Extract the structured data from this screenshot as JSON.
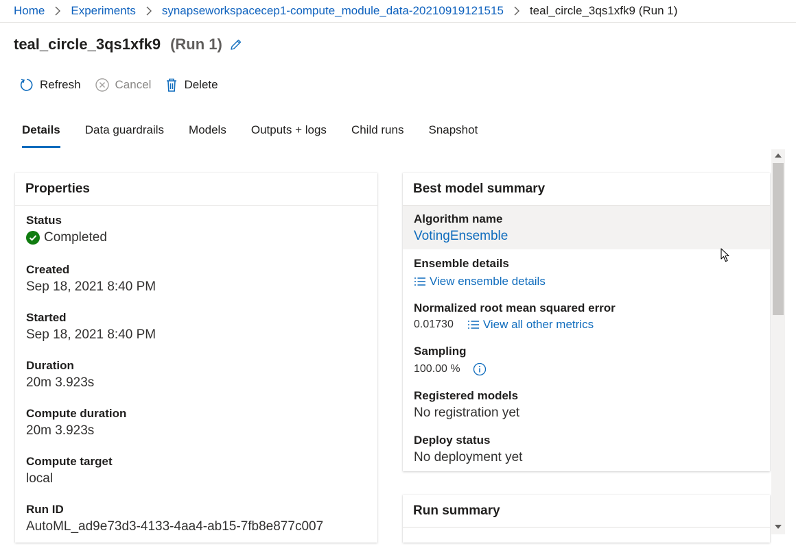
{
  "breadcrumb": {
    "home": "Home",
    "experiments": "Experiments",
    "experiment": "synapseworkspacecep1-compute_module_data-20210919121515",
    "current": "teal_circle_3qs1xfk9 (Run 1)"
  },
  "header": {
    "title": "teal_circle_3qs1xfk9",
    "run": "(Run 1)"
  },
  "toolbar": {
    "refresh": "Refresh",
    "cancel": "Cancel",
    "delete": "Delete"
  },
  "tabs": [
    "Details",
    "Data guardrails",
    "Models",
    "Outputs + logs",
    "Child runs",
    "Snapshot"
  ],
  "properties": {
    "title": "Properties",
    "status_label": "Status",
    "status_value": "Completed",
    "created_label": "Created",
    "created_value": "Sep 18, 2021 8:40 PM",
    "started_label": "Started",
    "started_value": "Sep 18, 2021 8:40 PM",
    "duration_label": "Duration",
    "duration_value": "20m 3.923s",
    "compute_duration_label": "Compute duration",
    "compute_duration_value": "20m 3.923s",
    "compute_target_label": "Compute target",
    "compute_target_value": "local",
    "run_id_label": "Run ID",
    "run_id_value": "AutoML_ad9e73d3-4133-4aa4-ab15-7fb8e877c007"
  },
  "best_model": {
    "title": "Best model summary",
    "algorithm_label": "Algorithm name",
    "algorithm_value": "VotingEnsemble",
    "ensemble_label": "Ensemble details",
    "ensemble_link": "View ensemble details",
    "nrmse_label": "Normalized root mean squared error",
    "nrmse_value": "0.01730",
    "metrics_link": "View all other metrics",
    "sampling_label": "Sampling",
    "sampling_value": "100.00 %",
    "registered_label": "Registered models",
    "registered_value": "No registration yet",
    "deploy_label": "Deploy status",
    "deploy_value": "No deployment yet"
  },
  "run_summary": {
    "title": "Run summary"
  },
  "colors": {
    "accent": "#0f6cbd",
    "success": "#107c10"
  }
}
